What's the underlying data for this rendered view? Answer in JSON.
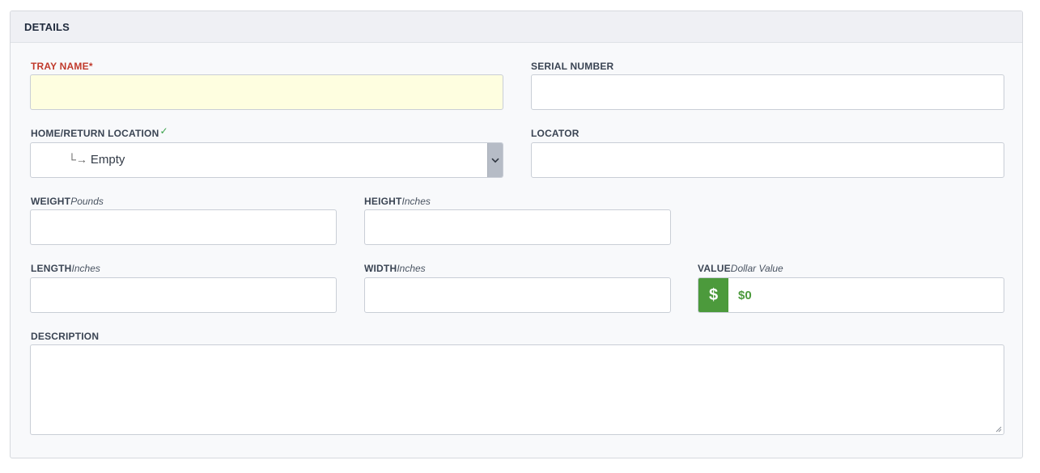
{
  "panel": {
    "title": "DETAILS"
  },
  "fields": {
    "tray_name": {
      "label": "TRAY NAME*",
      "value": ""
    },
    "serial_number": {
      "label": "SERIAL NUMBER",
      "value": ""
    },
    "home_return_location": {
      "label": "HOME/RETURN LOCATION",
      "check": "✓",
      "tree_glyph": "└→",
      "selected": "Empty"
    },
    "locator": {
      "label": "LOCATOR",
      "value": ""
    },
    "weight": {
      "label": "WEIGHT",
      "unit": "Pounds",
      "value": ""
    },
    "height": {
      "label": "HEIGHT",
      "unit": "Inches",
      "value": ""
    },
    "length": {
      "label": "LENGTH",
      "unit": "Inches",
      "value": ""
    },
    "width": {
      "label": "WIDTH",
      "unit": "Inches",
      "value": ""
    },
    "value": {
      "label": "VALUE",
      "unit": "Dollar Value",
      "addon": "$",
      "value": "$0"
    },
    "description": {
      "label": "DESCRIPTION",
      "value": ""
    }
  },
  "icons": {
    "select_arrow": "chevron-down-icon",
    "check": "check-icon",
    "resize": "resize-grip-icon"
  },
  "colors": {
    "required": "#c0392b",
    "check": "#3aa24a",
    "value_accent": "#4c9a3c",
    "highlight": "#fefee0"
  }
}
